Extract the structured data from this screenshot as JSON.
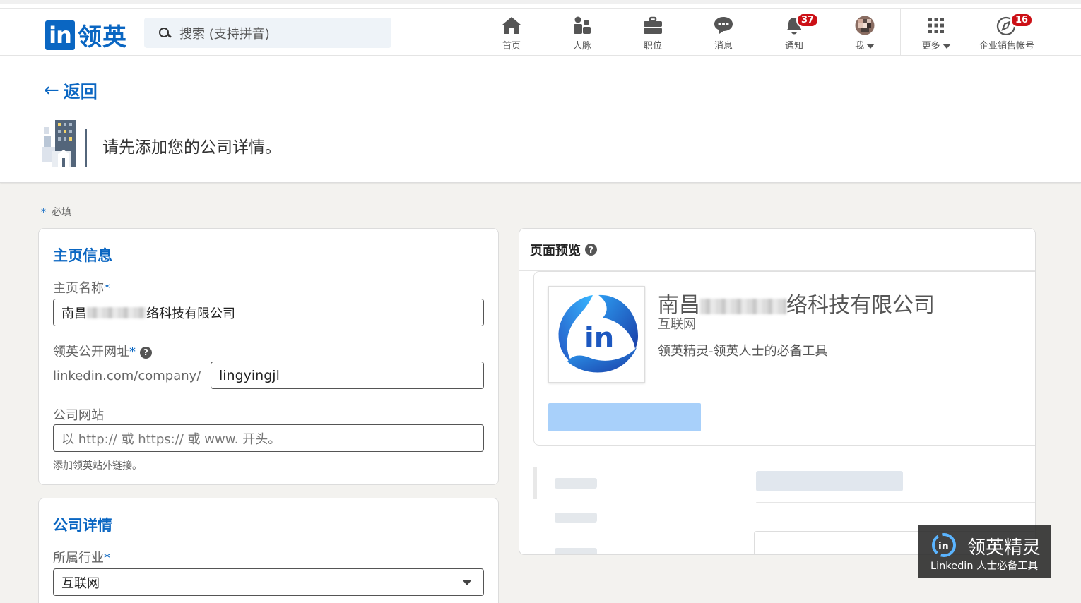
{
  "brand": {
    "logo_mark": "in",
    "logo_text": "领英",
    "accent": "#0a66c2"
  },
  "search": {
    "placeholder": "搜索 (支持拼音)"
  },
  "nav": {
    "home": "首页",
    "network": "人脉",
    "jobs": "职位",
    "messaging": "消息",
    "notifications": "通知",
    "notifications_badge": "37",
    "me": "我",
    "more": "更多",
    "sales": "企业销售帐号",
    "sales_badge": "16"
  },
  "header": {
    "back_label": "返回",
    "prompt": "请先添加您的公司详情。"
  },
  "required_note": {
    "star": "*",
    "text": "必填"
  },
  "page_info": {
    "title": "主页信息",
    "name_label": "主页名称",
    "name_value_prefix": "南昌",
    "name_value_suffix": "络科技有限公司",
    "url_label": "领英公开网址",
    "url_prefix": "linkedin.com/company/",
    "url_value": "lingyingjl",
    "website_label": "公司网站",
    "website_placeholder": "以 http:// 或 https:// 或 www. 开头。",
    "website_hint": "添加领英站外链接。"
  },
  "company_details": {
    "title": "公司详情",
    "industry_label": "所属行业",
    "industry_value": "互联网"
  },
  "preview": {
    "title": "页面预览",
    "name_prefix": "南昌",
    "name_suffix": "络科技有限公司",
    "industry": "互联网",
    "tagline": "领英精灵-领英人士的必备工具"
  },
  "watermark": {
    "title": "领英精灵",
    "subtitle": "Linkedin 人士必备工具"
  },
  "icons": {
    "home": "home-icon",
    "network": "people-icon",
    "jobs": "briefcase-icon",
    "messaging": "chat-icon",
    "notifications": "bell-icon",
    "more": "grid-icon",
    "sales": "compass-icon",
    "help": "question-icon",
    "back": "arrow-left-icon"
  }
}
